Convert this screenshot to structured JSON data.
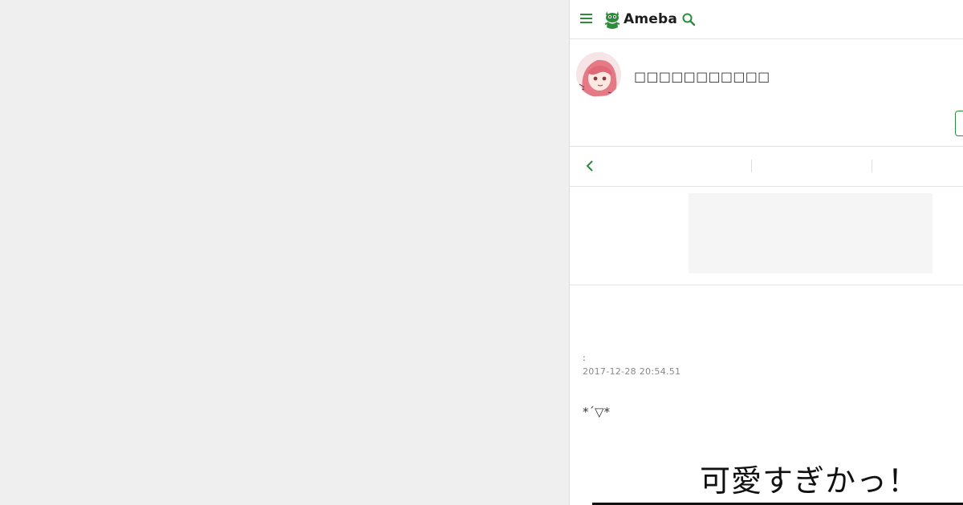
{
  "header": {
    "logo_text": "Ameba",
    "brand_color": "#2d8c3c",
    "icons": [
      "hamburger-menu-icon",
      "ameba-mascot-icon",
      "search-icon"
    ]
  },
  "profile": {
    "blog_title": "□□□□□□□□□□□"
  },
  "nav": {
    "icons": [
      "chevron-left-icon"
    ]
  },
  "article": {
    "theme_label": ":",
    "date": "2017-12-28 20:54.51",
    "body_text": "*´▽*",
    "image_caption": "可愛すぎかっ！"
  }
}
